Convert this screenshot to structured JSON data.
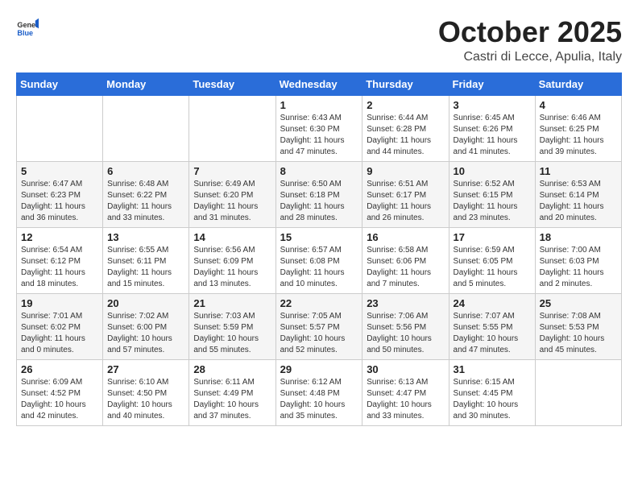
{
  "header": {
    "logo_general": "General",
    "logo_blue": "Blue",
    "month": "October 2025",
    "location": "Castri di Lecce, Apulia, Italy"
  },
  "weekdays": [
    "Sunday",
    "Monday",
    "Tuesday",
    "Wednesday",
    "Thursday",
    "Friday",
    "Saturday"
  ],
  "weeks": [
    [
      {
        "day": "",
        "info": ""
      },
      {
        "day": "",
        "info": ""
      },
      {
        "day": "",
        "info": ""
      },
      {
        "day": "1",
        "info": "Sunrise: 6:43 AM\nSunset: 6:30 PM\nDaylight: 11 hours\nand 47 minutes."
      },
      {
        "day": "2",
        "info": "Sunrise: 6:44 AM\nSunset: 6:28 PM\nDaylight: 11 hours\nand 44 minutes."
      },
      {
        "day": "3",
        "info": "Sunrise: 6:45 AM\nSunset: 6:26 PM\nDaylight: 11 hours\nand 41 minutes."
      },
      {
        "day": "4",
        "info": "Sunrise: 6:46 AM\nSunset: 6:25 PM\nDaylight: 11 hours\nand 39 minutes."
      }
    ],
    [
      {
        "day": "5",
        "info": "Sunrise: 6:47 AM\nSunset: 6:23 PM\nDaylight: 11 hours\nand 36 minutes."
      },
      {
        "day": "6",
        "info": "Sunrise: 6:48 AM\nSunset: 6:22 PM\nDaylight: 11 hours\nand 33 minutes."
      },
      {
        "day": "7",
        "info": "Sunrise: 6:49 AM\nSunset: 6:20 PM\nDaylight: 11 hours\nand 31 minutes."
      },
      {
        "day": "8",
        "info": "Sunrise: 6:50 AM\nSunset: 6:18 PM\nDaylight: 11 hours\nand 28 minutes."
      },
      {
        "day": "9",
        "info": "Sunrise: 6:51 AM\nSunset: 6:17 PM\nDaylight: 11 hours\nand 26 minutes."
      },
      {
        "day": "10",
        "info": "Sunrise: 6:52 AM\nSunset: 6:15 PM\nDaylight: 11 hours\nand 23 minutes."
      },
      {
        "day": "11",
        "info": "Sunrise: 6:53 AM\nSunset: 6:14 PM\nDaylight: 11 hours\nand 20 minutes."
      }
    ],
    [
      {
        "day": "12",
        "info": "Sunrise: 6:54 AM\nSunset: 6:12 PM\nDaylight: 11 hours\nand 18 minutes."
      },
      {
        "day": "13",
        "info": "Sunrise: 6:55 AM\nSunset: 6:11 PM\nDaylight: 11 hours\nand 15 minutes."
      },
      {
        "day": "14",
        "info": "Sunrise: 6:56 AM\nSunset: 6:09 PM\nDaylight: 11 hours\nand 13 minutes."
      },
      {
        "day": "15",
        "info": "Sunrise: 6:57 AM\nSunset: 6:08 PM\nDaylight: 11 hours\nand 10 minutes."
      },
      {
        "day": "16",
        "info": "Sunrise: 6:58 AM\nSunset: 6:06 PM\nDaylight: 11 hours\nand 7 minutes."
      },
      {
        "day": "17",
        "info": "Sunrise: 6:59 AM\nSunset: 6:05 PM\nDaylight: 11 hours\nand 5 minutes."
      },
      {
        "day": "18",
        "info": "Sunrise: 7:00 AM\nSunset: 6:03 PM\nDaylight: 11 hours\nand 2 minutes."
      }
    ],
    [
      {
        "day": "19",
        "info": "Sunrise: 7:01 AM\nSunset: 6:02 PM\nDaylight: 11 hours\nand 0 minutes."
      },
      {
        "day": "20",
        "info": "Sunrise: 7:02 AM\nSunset: 6:00 PM\nDaylight: 10 hours\nand 57 minutes."
      },
      {
        "day": "21",
        "info": "Sunrise: 7:03 AM\nSunset: 5:59 PM\nDaylight: 10 hours\nand 55 minutes."
      },
      {
        "day": "22",
        "info": "Sunrise: 7:05 AM\nSunset: 5:57 PM\nDaylight: 10 hours\nand 52 minutes."
      },
      {
        "day": "23",
        "info": "Sunrise: 7:06 AM\nSunset: 5:56 PM\nDaylight: 10 hours\nand 50 minutes."
      },
      {
        "day": "24",
        "info": "Sunrise: 7:07 AM\nSunset: 5:55 PM\nDaylight: 10 hours\nand 47 minutes."
      },
      {
        "day": "25",
        "info": "Sunrise: 7:08 AM\nSunset: 5:53 PM\nDaylight: 10 hours\nand 45 minutes."
      }
    ],
    [
      {
        "day": "26",
        "info": "Sunrise: 6:09 AM\nSunset: 4:52 PM\nDaylight: 10 hours\nand 42 minutes."
      },
      {
        "day": "27",
        "info": "Sunrise: 6:10 AM\nSunset: 4:50 PM\nDaylight: 10 hours\nand 40 minutes."
      },
      {
        "day": "28",
        "info": "Sunrise: 6:11 AM\nSunset: 4:49 PM\nDaylight: 10 hours\nand 37 minutes."
      },
      {
        "day": "29",
        "info": "Sunrise: 6:12 AM\nSunset: 4:48 PM\nDaylight: 10 hours\nand 35 minutes."
      },
      {
        "day": "30",
        "info": "Sunrise: 6:13 AM\nSunset: 4:47 PM\nDaylight: 10 hours\nand 33 minutes."
      },
      {
        "day": "31",
        "info": "Sunrise: 6:15 AM\nSunset: 4:45 PM\nDaylight: 10 hours\nand 30 minutes."
      },
      {
        "day": "",
        "info": ""
      }
    ]
  ]
}
